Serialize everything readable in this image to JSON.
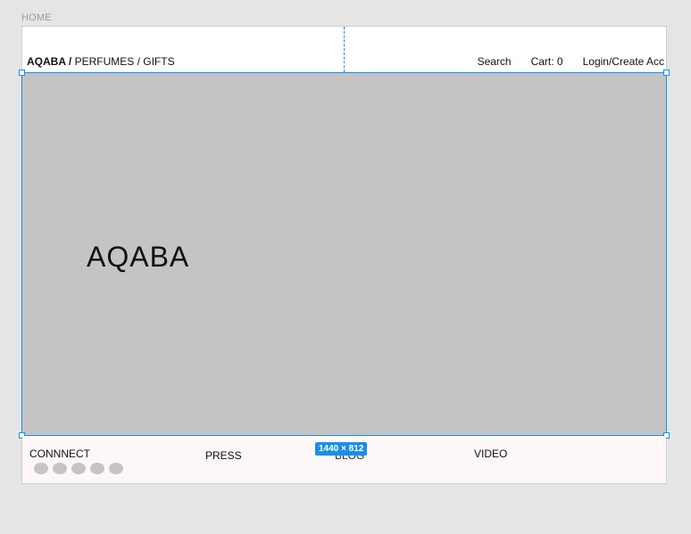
{
  "frame": {
    "label": "HOME",
    "size_badge": "1440 × 812"
  },
  "header": {
    "brand": "AQABA /",
    "nav": "PERFUMES / GIFTS",
    "search": "Search",
    "cart": "Cart: 0",
    "login": "Login/Create Acc"
  },
  "hero": {
    "title": "AQABA"
  },
  "footer": {
    "connect": "CONNNECT",
    "press": "PRESS",
    "blog": "BLOG",
    "video": "VIDEO",
    "social_icons": [
      "social-icon-1",
      "social-icon-2",
      "social-icon-3",
      "social-icon-4",
      "social-icon-5"
    ]
  },
  "colors": {
    "canvas": "#e5e5e5",
    "hero": "#c4c4c4",
    "selection": "#1a8ee8",
    "footer": "#fdf8f7"
  }
}
